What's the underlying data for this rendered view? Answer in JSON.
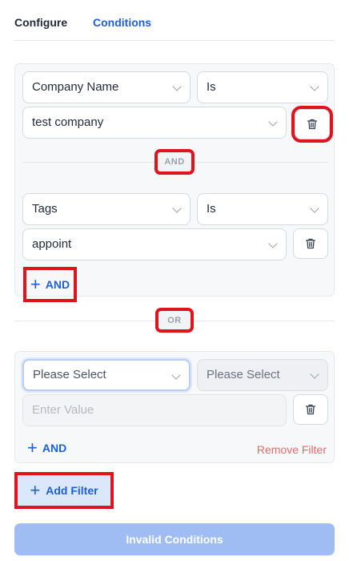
{
  "tabs": [
    {
      "label": "Configure"
    },
    {
      "label": "Conditions"
    }
  ],
  "groups": [
    {
      "conditions": [
        {
          "field": "Company Name",
          "operator": "Is",
          "value": "test company"
        },
        {
          "field": "Tags",
          "operator": "Is",
          "value": "appoint"
        }
      ],
      "and_separator": "AND",
      "add_and_label": "AND"
    },
    {
      "conditions": [
        {
          "field_placeholder": "Please Select",
          "operator_placeholder": "Please Select",
          "value_placeholder": "Enter Value"
        }
      ],
      "add_and_label": "AND",
      "remove_label": "Remove Filter"
    }
  ],
  "or_separator": "OR",
  "add_filter_label": "Add Filter",
  "submit_label": "Invalid Conditions",
  "icons": {
    "trash": "trash-icon",
    "plus": "plus-icon",
    "chevron": "chevron-down-icon"
  },
  "colors": {
    "accent": "#1d5fd6",
    "danger": "#e36a6a",
    "highlight": "#e0141c",
    "submit_disabled": "#9fbdf3"
  }
}
